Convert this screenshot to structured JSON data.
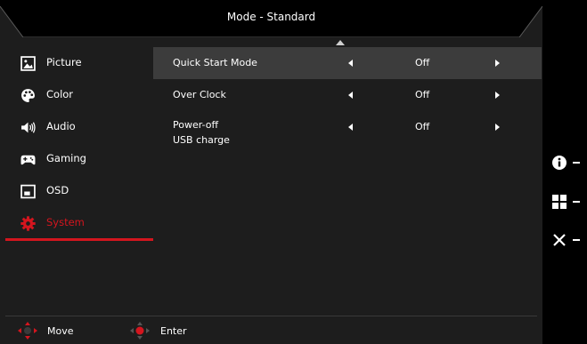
{
  "header": {
    "title": "Mode - Standard"
  },
  "sidebar": {
    "items": [
      {
        "label": "Picture",
        "icon": "picture-icon"
      },
      {
        "label": "Color",
        "icon": "palette-icon"
      },
      {
        "label": "Audio",
        "icon": "speaker-icon"
      },
      {
        "label": "Gaming",
        "icon": "gamepad-icon"
      },
      {
        "label": "OSD",
        "icon": "osd-icon"
      },
      {
        "label": "System",
        "icon": "gear-icon",
        "active": true
      }
    ]
  },
  "settings": {
    "rows": [
      {
        "label": "Quick Start Mode",
        "value": "Off",
        "selected": true
      },
      {
        "label": "Over Clock",
        "value": "Off"
      },
      {
        "label": "Power-off",
        "label2": "USB charge",
        "value": "Off"
      }
    ]
  },
  "footer": {
    "move_label": "Move",
    "enter_label": "Enter"
  },
  "hotkeys": [
    {
      "icon": "info-icon"
    },
    {
      "icon": "grid-icon"
    },
    {
      "icon": "close-icon"
    }
  ],
  "colors": {
    "accent": "#d4151e",
    "panel": "#1d1d1d",
    "selected_row": "#3c3c3c"
  }
}
